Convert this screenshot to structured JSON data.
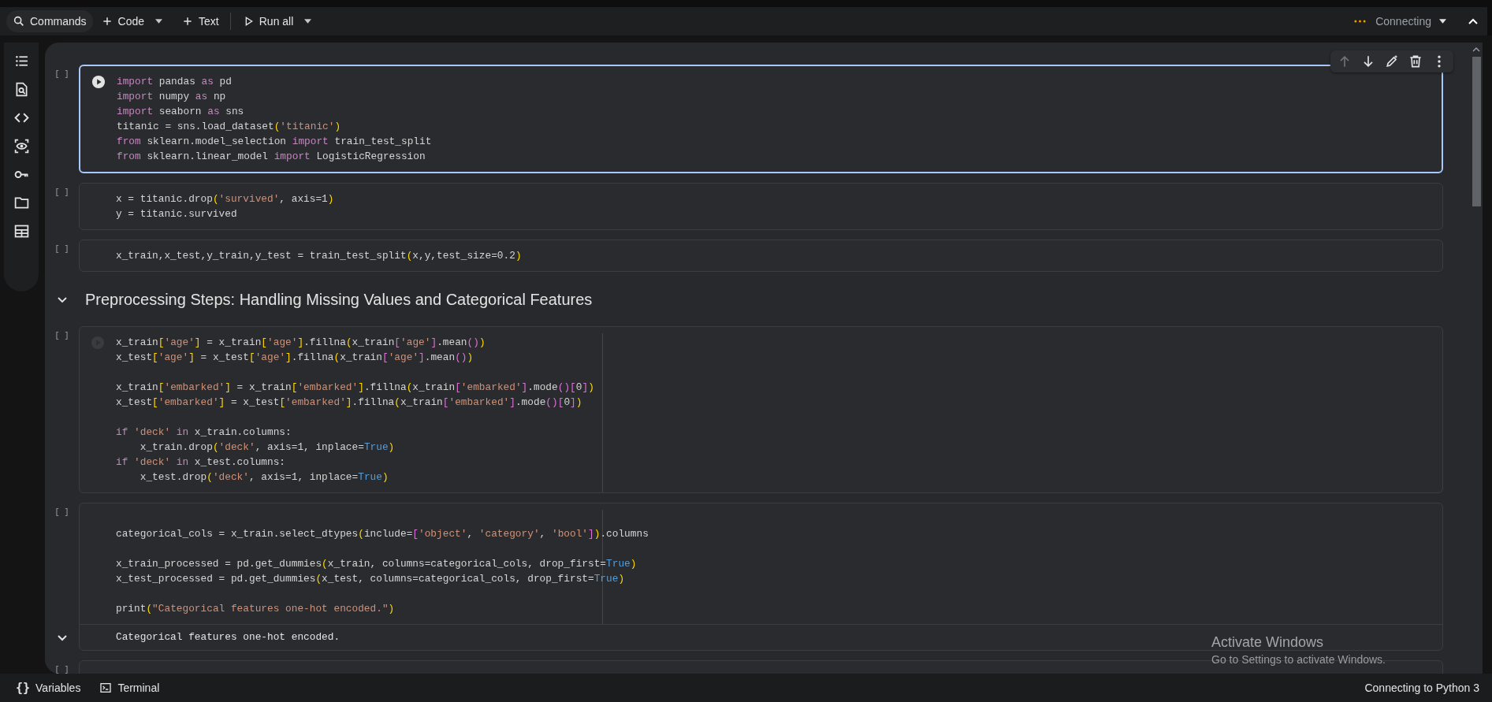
{
  "toolbar": {
    "items": [
      {
        "kind": "search",
        "label": "Commands"
      },
      {
        "kind": "add",
        "label": "Code",
        "dropdown": true
      },
      {
        "kind": "add",
        "label": "Text",
        "dropdown": false
      },
      {
        "kind": "run",
        "label": "Run all",
        "dropdown": true
      }
    ],
    "status": "Connecting"
  },
  "cells": [
    {
      "kind": "code",
      "prompt": "[ ]",
      "selected": true,
      "hovered": false,
      "ruler": false,
      "toolbar": {
        "up_disabled": true
      },
      "lines": [
        {
          "kind": "code",
          "segments": [
            {
              "text": "import",
              "kind": "keyword"
            },
            {
              "text": " pandas "
            },
            {
              "text": "as",
              "kind": "keyword"
            },
            {
              "text": " pd"
            }
          ]
        },
        {
          "kind": "code",
          "segments": [
            {
              "text": "import",
              "kind": "keyword"
            },
            {
              "text": " numpy "
            },
            {
              "text": "as",
              "kind": "keyword"
            },
            {
              "text": " np"
            }
          ]
        },
        {
          "kind": "code",
          "segments": [
            {
              "text": "import",
              "kind": "keyword"
            },
            {
              "text": " seaborn "
            },
            {
              "text": "as",
              "kind": "keyword"
            },
            {
              "text": " sns"
            }
          ]
        },
        {
          "kind": "code",
          "segments": [
            {
              "text": "titanic = sns.load_dataset"
            },
            {
              "text": "(",
              "kind": "b1"
            },
            {
              "text": "'titanic'",
              "kind": "string"
            },
            {
              "text": ")",
              "kind": "b1"
            }
          ]
        },
        {
          "kind": "code",
          "segments": [
            {
              "text": "from",
              "kind": "keyword"
            },
            {
              "text": " sklearn.model_selection "
            },
            {
              "text": "import",
              "kind": "keyword"
            },
            {
              "text": " train_test_split"
            }
          ]
        },
        {
          "kind": "code",
          "segments": [
            {
              "text": "from",
              "kind": "keyword"
            },
            {
              "text": " sklearn.linear_model "
            },
            {
              "text": "import",
              "kind": "keyword"
            },
            {
              "text": " LogisticRegression"
            }
          ]
        }
      ]
    },
    {
      "kind": "code",
      "prompt": "[ ]",
      "selected": false,
      "hovered": false,
      "ruler": false,
      "lines": [
        {
          "kind": "code",
          "segments": [
            {
              "text": "x = titanic.drop"
            },
            {
              "text": "(",
              "kind": "b1"
            },
            {
              "text": "'survived'",
              "kind": "string"
            },
            {
              "text": ", axis=1"
            },
            {
              "text": ")",
              "kind": "b1"
            }
          ]
        },
        {
          "kind": "code",
          "segments": [
            {
              "text": "y = titanic.survived"
            }
          ]
        }
      ]
    },
    {
      "kind": "code",
      "prompt": "[ ]",
      "selected": false,
      "hovered": false,
      "ruler": false,
      "lines": [
        {
          "kind": "code",
          "segments": [
            {
              "text": "x_train,x_test,y_train,y_test = train_test_split"
            },
            {
              "text": "(",
              "kind": "b1"
            },
            {
              "text": "x,y,test_size=0.2"
            },
            {
              "text": ")",
              "kind": "b1"
            }
          ]
        }
      ]
    },
    {
      "kind": "heading",
      "text": "Preprocessing Steps: Handling Missing Values and Categorical Features",
      "expanded": true
    },
    {
      "kind": "code",
      "prompt": "[ ]",
      "selected": false,
      "hovered": true,
      "ruler": true,
      "lines": [
        {
          "kind": "code",
          "segments": [
            {
              "text": "x_train"
            },
            {
              "text": "[",
              "kind": "b1"
            },
            {
              "text": "'age'",
              "kind": "string"
            },
            {
              "text": "]",
              "kind": "b1"
            },
            {
              "text": " = x_train"
            },
            {
              "text": "[",
              "kind": "b1"
            },
            {
              "text": "'age'",
              "kind": "string"
            },
            {
              "text": "]",
              "kind": "b1"
            },
            {
              "text": ".fillna"
            },
            {
              "text": "(",
              "kind": "b1"
            },
            {
              "text": "x_train"
            },
            {
              "text": "[",
              "kind": "b2"
            },
            {
              "text": "'age'",
              "kind": "string"
            },
            {
              "text": "]",
              "kind": "b2"
            },
            {
              "text": ".mean"
            },
            {
              "text": "()",
              "kind": "b2"
            },
            {
              "text": ")",
              "kind": "b1"
            }
          ]
        },
        {
          "kind": "code",
          "segments": [
            {
              "text": "x_test"
            },
            {
              "text": "[",
              "kind": "b1"
            },
            {
              "text": "'age'",
              "kind": "string"
            },
            {
              "text": "]",
              "kind": "b1"
            },
            {
              "text": " = x_test"
            },
            {
              "text": "[",
              "kind": "b1"
            },
            {
              "text": "'age'",
              "kind": "string"
            },
            {
              "text": "]",
              "kind": "b1"
            },
            {
              "text": ".fillna"
            },
            {
              "text": "(",
              "kind": "b1"
            },
            {
              "text": "x_train"
            },
            {
              "text": "[",
              "kind": "b2"
            },
            {
              "text": "'age'",
              "kind": "string"
            },
            {
              "text": "]",
              "kind": "b2"
            },
            {
              "text": ".mean"
            },
            {
              "text": "()",
              "kind": "b2"
            },
            {
              "text": ")",
              "kind": "b1"
            }
          ]
        },
        {
          "kind": "blank"
        },
        {
          "kind": "code",
          "segments": [
            {
              "text": "x_train"
            },
            {
              "text": "[",
              "kind": "b1"
            },
            {
              "text": "'embarked'",
              "kind": "string"
            },
            {
              "text": "]",
              "kind": "b1"
            },
            {
              "text": " = x_train"
            },
            {
              "text": "[",
              "kind": "b1"
            },
            {
              "text": "'embarked'",
              "kind": "string"
            },
            {
              "text": "]",
              "kind": "b1"
            },
            {
              "text": ".fillna"
            },
            {
              "text": "(",
              "kind": "b1"
            },
            {
              "text": "x_train"
            },
            {
              "text": "[",
              "kind": "b2"
            },
            {
              "text": "'embarked'",
              "kind": "string"
            },
            {
              "text": "]",
              "kind": "b2"
            },
            {
              "text": ".mode"
            },
            {
              "text": "()",
              "kind": "b2"
            },
            {
              "text": "[",
              "kind": "b2"
            },
            {
              "text": "0"
            },
            {
              "text": "]",
              "kind": "b2"
            },
            {
              "text": ")",
              "kind": "b1"
            }
          ]
        },
        {
          "kind": "code",
          "segments": [
            {
              "text": "x_test"
            },
            {
              "text": "[",
              "kind": "b1"
            },
            {
              "text": "'embarked'",
              "kind": "string"
            },
            {
              "text": "]",
              "kind": "b1"
            },
            {
              "text": " = x_test"
            },
            {
              "text": "[",
              "kind": "b1"
            },
            {
              "text": "'embarked'",
              "kind": "string"
            },
            {
              "text": "]",
              "kind": "b1"
            },
            {
              "text": ".fillna"
            },
            {
              "text": "(",
              "kind": "b1"
            },
            {
              "text": "x_train"
            },
            {
              "text": "[",
              "kind": "b2"
            },
            {
              "text": "'embarked'",
              "kind": "string"
            },
            {
              "text": "]",
              "kind": "b2"
            },
            {
              "text": ".mode"
            },
            {
              "text": "()",
              "kind": "b2"
            },
            {
              "text": "[",
              "kind": "b2"
            },
            {
              "text": "0"
            },
            {
              "text": "]",
              "kind": "b2"
            },
            {
              "text": ")",
              "kind": "b1"
            }
          ]
        },
        {
          "kind": "blank"
        },
        {
          "kind": "code",
          "segments": [
            {
              "text": "if ",
              "kind": "keyword"
            },
            {
              "text": "'deck'",
              "kind": "string"
            },
            {
              "text": " in",
              "kind": "keyword"
            },
            {
              "text": " x_train.columns:"
            }
          ]
        },
        {
          "kind": "code",
          "segments": [
            {
              "text": "    x_train.drop"
            },
            {
              "text": "(",
              "kind": "b1"
            },
            {
              "text": "'deck'",
              "kind": "string"
            },
            {
              "text": ", axis=1, inplace="
            },
            {
              "text": "True",
              "kind": "constant"
            },
            {
              "text": ")",
              "kind": "b1"
            }
          ]
        },
        {
          "kind": "code",
          "segments": [
            {
              "text": "if ",
              "kind": "keyword"
            },
            {
              "text": "'deck'",
              "kind": "string"
            },
            {
              "text": " in",
              "kind": "keyword"
            },
            {
              "text": " x_test.columns:"
            }
          ]
        },
        {
          "kind": "code",
          "segments": [
            {
              "text": "    x_test.drop"
            },
            {
              "text": "(",
              "kind": "b1"
            },
            {
              "text": "'deck'",
              "kind": "string"
            },
            {
              "text": ", axis=1, inplace="
            },
            {
              "text": "True",
              "kind": "constant"
            },
            {
              "text": ")",
              "kind": "b1"
            }
          ]
        }
      ]
    },
    {
      "kind": "code",
      "prompt": "[ ]",
      "selected": false,
      "hovered": false,
      "ruler": true,
      "lines": [
        {
          "kind": "blank"
        },
        {
          "kind": "code",
          "segments": [
            {
              "text": "categorical_cols = x_train.select_dtypes"
            },
            {
              "text": "(",
              "kind": "b1"
            },
            {
              "text": "include="
            },
            {
              "text": "[",
              "kind": "b2"
            },
            {
              "text": "'object'",
              "kind": "string"
            },
            {
              "text": ", "
            },
            {
              "text": "'category'",
              "kind": "string"
            },
            {
              "text": ", "
            },
            {
              "text": "'bool'",
              "kind": "string"
            },
            {
              "text": "]",
              "kind": "b2"
            },
            {
              "text": ")",
              "kind": "b1"
            },
            {
              "text": ".columns"
            }
          ]
        },
        {
          "kind": "blank"
        },
        {
          "kind": "code",
          "segments": [
            {
              "text": "x_train_processed = pd.get_dummies"
            },
            {
              "text": "(",
              "kind": "b1"
            },
            {
              "text": "x_train, columns=categorical_cols, drop_first="
            },
            {
              "text": "True",
              "kind": "constant"
            },
            {
              "text": ")",
              "kind": "b1"
            }
          ]
        },
        {
          "kind": "code",
          "segments": [
            {
              "text": "x_test_processed = pd.get_dummies"
            },
            {
              "text": "(",
              "kind": "b1"
            },
            {
              "text": "x_test, columns=categorical_cols, drop_first="
            },
            {
              "text": "True",
              "kind": "constant"
            },
            {
              "text": ")",
              "kind": "b1"
            }
          ]
        },
        {
          "kind": "blank"
        },
        {
          "kind": "code",
          "segments": [
            {
              "text": "print"
            },
            {
              "text": "(",
              "kind": "b1"
            },
            {
              "text": "\"Categorical features one-hot encoded.\"",
              "kind": "string"
            },
            {
              "text": ")",
              "kind": "b1"
            }
          ]
        }
      ],
      "output": {
        "text": "Categorical features one-hot encoded.",
        "expanded": true
      }
    },
    {
      "kind": "code",
      "prompt": "[ ]",
      "selected": false,
      "hovered": false,
      "ruler": false
    }
  ],
  "activation": {
    "title": "Activate Windows",
    "hint": "Go to Settings to activate Windows."
  },
  "bottom_bar": {
    "variables": {
      "glyph": "{}",
      "label": "Variables"
    },
    "terminal": {
      "label": "Terminal"
    },
    "status": "Connecting to Python 3"
  }
}
